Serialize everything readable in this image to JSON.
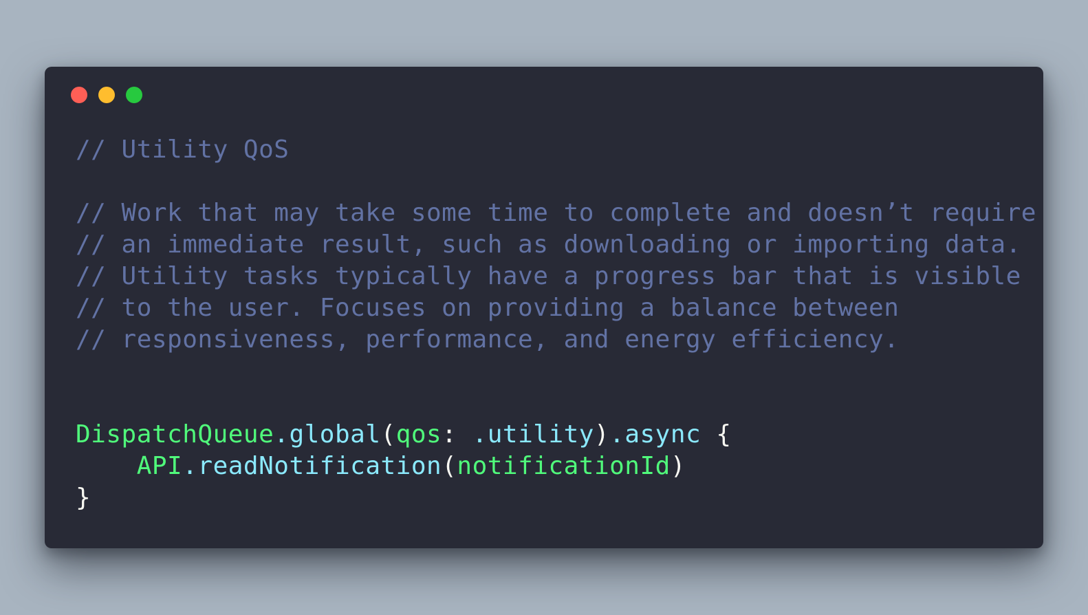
{
  "window": {
    "traffic_lights": [
      {
        "name": "close",
        "color": "#ff5555"
      },
      {
        "name": "minimize",
        "color": "#ffb86c"
      },
      {
        "name": "zoom",
        "color": "#28c940"
      }
    ]
  },
  "colors": {
    "background": "#a8b4c0",
    "editor": "#282a36",
    "comment": "#6272a4",
    "class": "#50fa7b",
    "method": "#8be9fd",
    "plain": "#f8f8f2"
  },
  "code": {
    "comment_title": "// Utility QoS",
    "comment_lines": [
      "// Work that may take some time to complete and doesn’t require",
      "// an immediate result, such as downloading or importing data.",
      "// Utility tasks typically have a progress bar that is visible",
      "// to the user. Focuses on providing a balance between",
      "// responsiveness, performance, and energy efficiency."
    ],
    "line1": {
      "class": "DispatchQueue",
      "dot1": ".",
      "method": "global",
      "open_paren": "(",
      "param": "qos",
      "colon": ": ",
      "value": ".utility",
      "close_paren": ")",
      "async": ".async",
      "brace": " {"
    },
    "line2": {
      "indent": "    ",
      "class": "API",
      "method": ".readNotification",
      "open_paren": "(",
      "arg": "notificationId",
      "close_paren": ")"
    },
    "line3": {
      "brace": "}"
    }
  }
}
